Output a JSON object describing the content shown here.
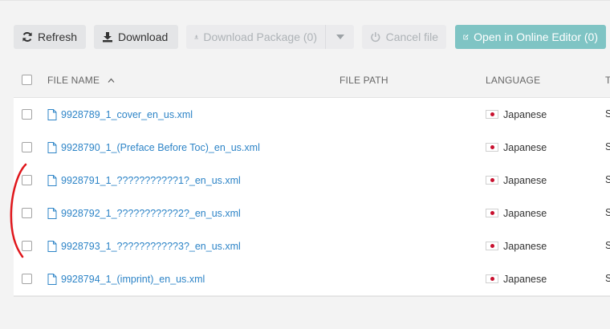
{
  "toolbar": {
    "refresh": {
      "label": "Refresh",
      "icon": "refresh-icon"
    },
    "download": {
      "label": "Download",
      "icon": "download-icon"
    },
    "download_package": {
      "label": "Download Package (0)",
      "icon": "download-icon",
      "disabled": true
    },
    "cancel_file": {
      "label": "Cancel file",
      "icon": "power-icon",
      "disabled": true
    },
    "open_editor": {
      "label": "Open in Online Editor (0)",
      "icon": "edit-icon"
    }
  },
  "table": {
    "columns": {
      "file_name": "FILE NAME",
      "file_path": "FILE PATH",
      "language": "LANGUAGE",
      "truncated": "T"
    },
    "sort": {
      "column": "file_name",
      "direction": "ascending"
    },
    "rows": [
      {
        "file_name": "9928789_1_cover_en_us.xml",
        "language": "Japanese",
        "truncated": "S"
      },
      {
        "file_name": "9928790_1_(Preface Before Toc)_en_us.xml",
        "language": "Japanese",
        "truncated": "S"
      },
      {
        "file_name": "9928791_1_???????????1?_en_us.xml",
        "language": "Japanese",
        "truncated": "S"
      },
      {
        "file_name": "9928792_1_???????????2?_en_us.xml",
        "language": "Japanese",
        "truncated": "S"
      },
      {
        "file_name": "9928793_1_???????????3?_en_us.xml",
        "language": "Japanese",
        "truncated": "S"
      },
      {
        "file_name": "9928794_1_(imprint)_en_us.xml",
        "language": "Japanese",
        "truncated": "S"
      }
    ]
  },
  "colors": {
    "link": "#2d84c7",
    "primary_button": "#7fc4c4",
    "annotation_mark": "#e0161b"
  }
}
